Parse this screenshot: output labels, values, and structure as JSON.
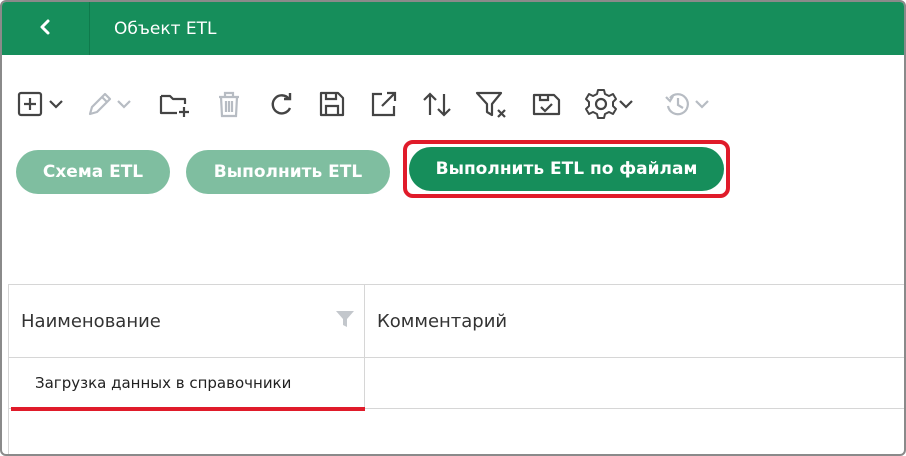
{
  "header": {
    "back_icon": "chevron-left-icon",
    "title": "Объект ETL",
    "color": "#168e5b"
  },
  "toolbar": {
    "icons": [
      "add-icon",
      "edit-icon",
      "add-folder-icon",
      "delete-icon",
      "refresh-icon",
      "save-icon",
      "export-icon",
      "sort-icon",
      "clear-filter-icon",
      "save-view-icon",
      "settings-icon",
      "history-icon"
    ]
  },
  "buttons": {
    "schema_label": "Схема ETL",
    "run_label": "Выполнить ETL",
    "run_files_label": "Выполнить ETL по файлам"
  },
  "table": {
    "columns": [
      "Наименование",
      "Комментарий"
    ],
    "rows": [
      {
        "name": "Загрузка данных в справочники",
        "comment": ""
      }
    ]
  },
  "colors": {
    "accent": "#168e5b",
    "button_light": "#7fbea0",
    "highlight": "#e01b2a"
  }
}
